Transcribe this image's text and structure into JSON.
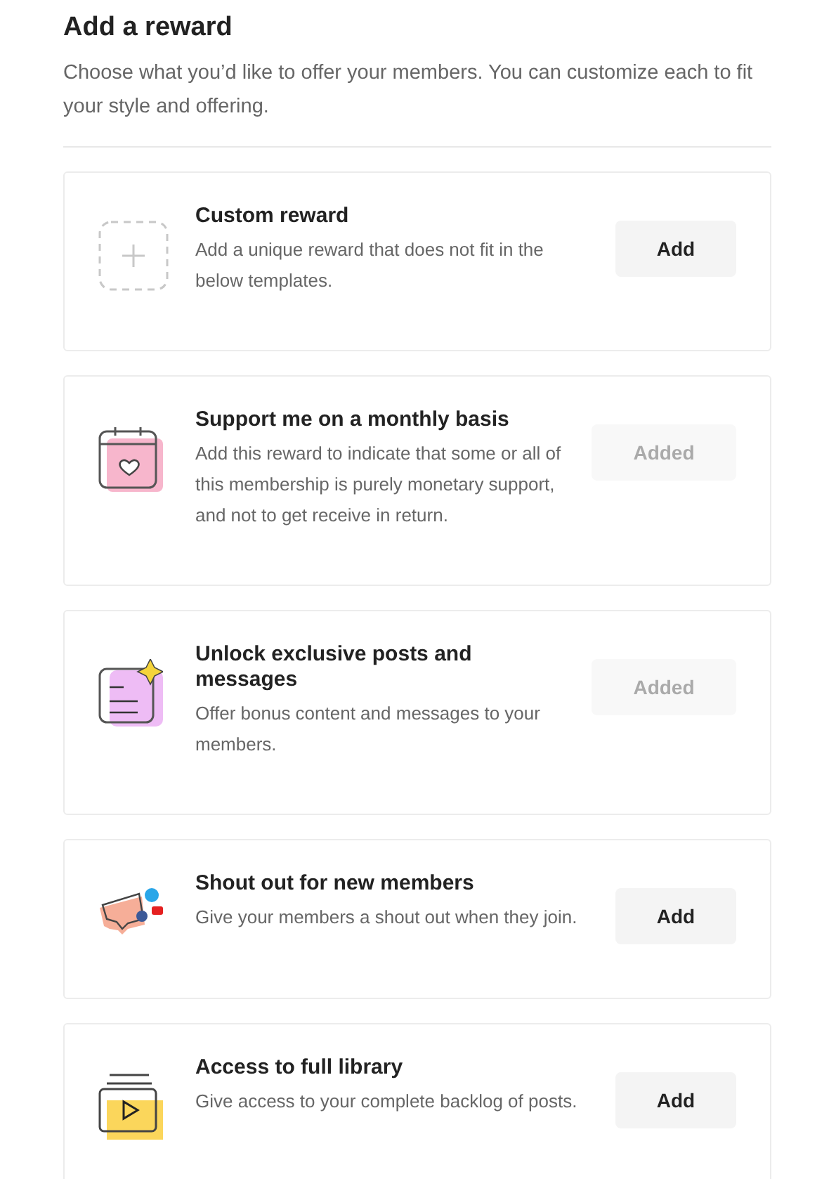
{
  "title": "Add a reward",
  "subtitle": "Choose what you’d like to offer your members. You can customize each to fit your style and offering.",
  "rewards": [
    {
      "kind": "custom",
      "title": "Custom reward",
      "description": "Add a unique reward that does not fit in the below templates.",
      "button": "Add",
      "added": false
    },
    {
      "kind": "calendar",
      "title": "Support me on a monthly basis",
      "description": "Add this reward to indicate that some or all of this membership is purely monetary support, and not to get receive in return.",
      "button": "Added",
      "added": true
    },
    {
      "kind": "posts",
      "title": "Unlock exclusive posts and messages",
      "description": "Offer bonus content and messages to your members.",
      "button": "Added",
      "added": true
    },
    {
      "kind": "shoutout",
      "title": "Shout out for new members",
      "description": "Give your members a shout out when they join.",
      "button": "Add",
      "added": false
    },
    {
      "kind": "library",
      "title": "Access to full library",
      "description": "Give access to your complete backlog of posts.",
      "button": "Add",
      "added": false
    }
  ]
}
